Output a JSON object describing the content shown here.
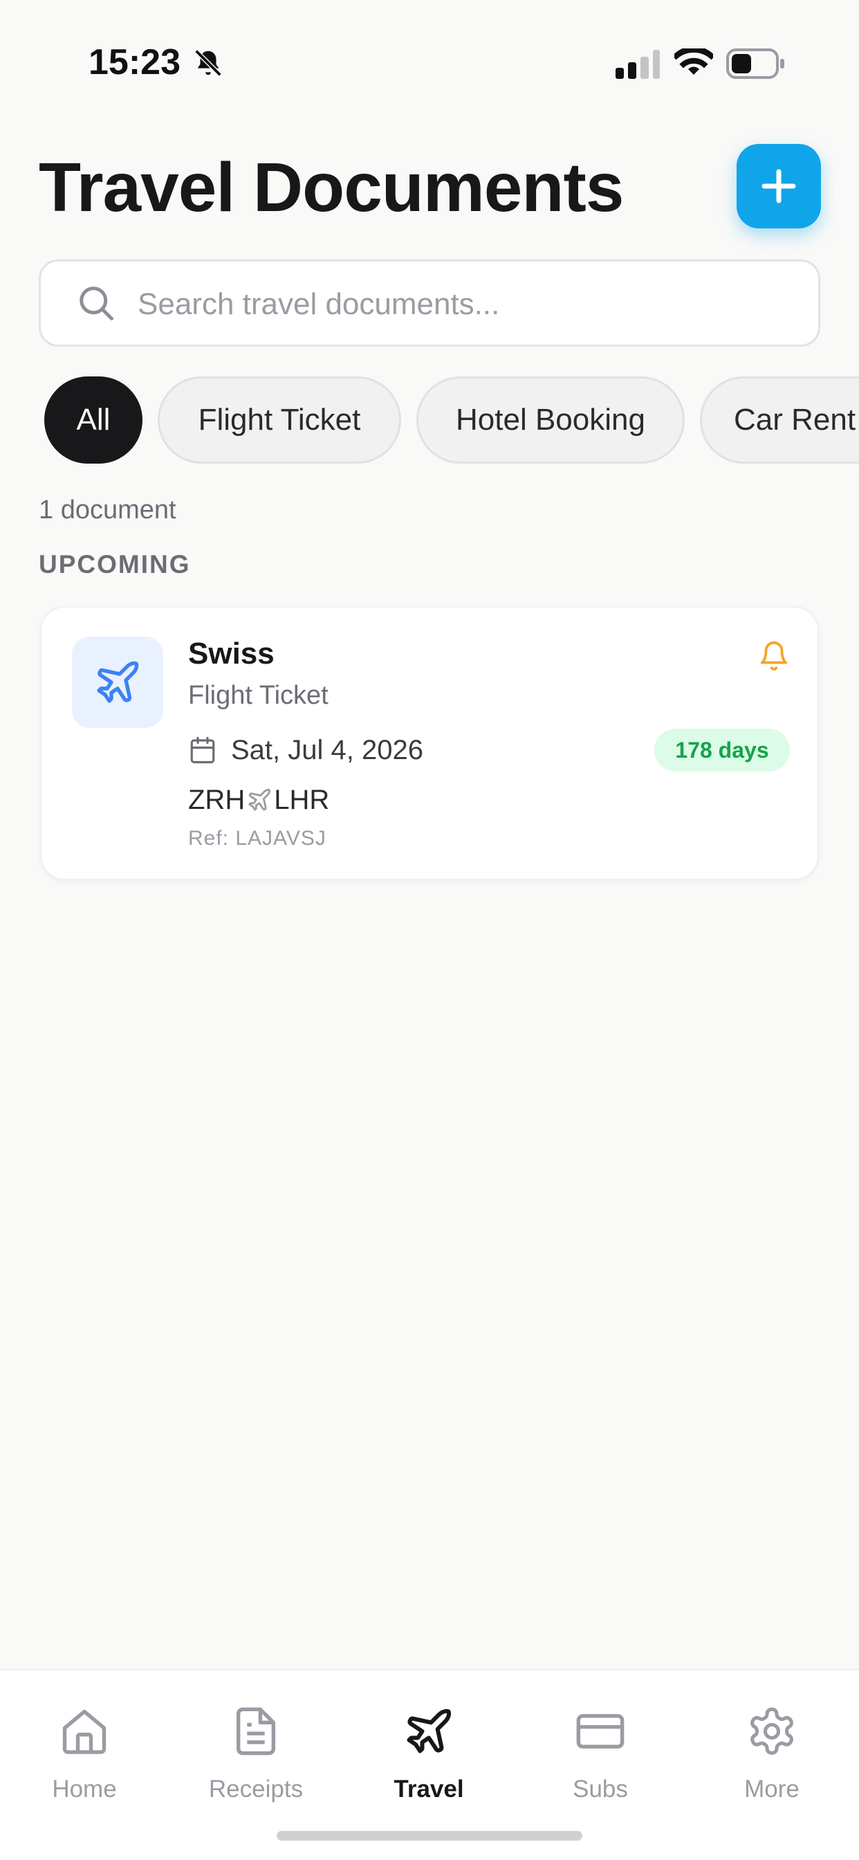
{
  "status_bar": {
    "time": "15:23"
  },
  "header": {
    "title": "Travel Documents",
    "add_icon": "plus-icon"
  },
  "search": {
    "placeholder": "Search travel documents...",
    "value": ""
  },
  "filters": [
    {
      "label": "All",
      "active": true
    },
    {
      "label": "Flight Ticket",
      "active": false
    },
    {
      "label": "Hotel Booking",
      "active": false
    },
    {
      "label": "Car Rent",
      "active": false
    }
  ],
  "summary": {
    "count_text": "1 document"
  },
  "sections": [
    {
      "heading": "UPCOMING",
      "items": [
        {
          "title": "Swiss",
          "type": "Flight Ticket",
          "icon": "airplane-icon",
          "date": "Sat, Jul 4, 2026",
          "days_until": "178 days",
          "route_from": "ZRH",
          "route_to": "LHR",
          "ref": "Ref: LAJAVSJ",
          "reminder_icon": "bell-icon"
        }
      ]
    }
  ],
  "tabs": [
    {
      "label": "Home",
      "icon": "home-icon",
      "active": false
    },
    {
      "label": "Receipts",
      "icon": "receipt-icon",
      "active": false
    },
    {
      "label": "Travel",
      "icon": "airplane-icon",
      "active": true
    },
    {
      "label": "Subs",
      "icon": "card-icon",
      "active": false
    },
    {
      "label": "More",
      "icon": "gear-icon",
      "active": false
    }
  ],
  "colors": {
    "accent": "#10a5e9",
    "chip_active": "#18181a",
    "badge_bg": "#dcfce7",
    "badge_text": "#16a34a",
    "reminder": "#f5a524",
    "icon_blue": "#3b82f6"
  }
}
